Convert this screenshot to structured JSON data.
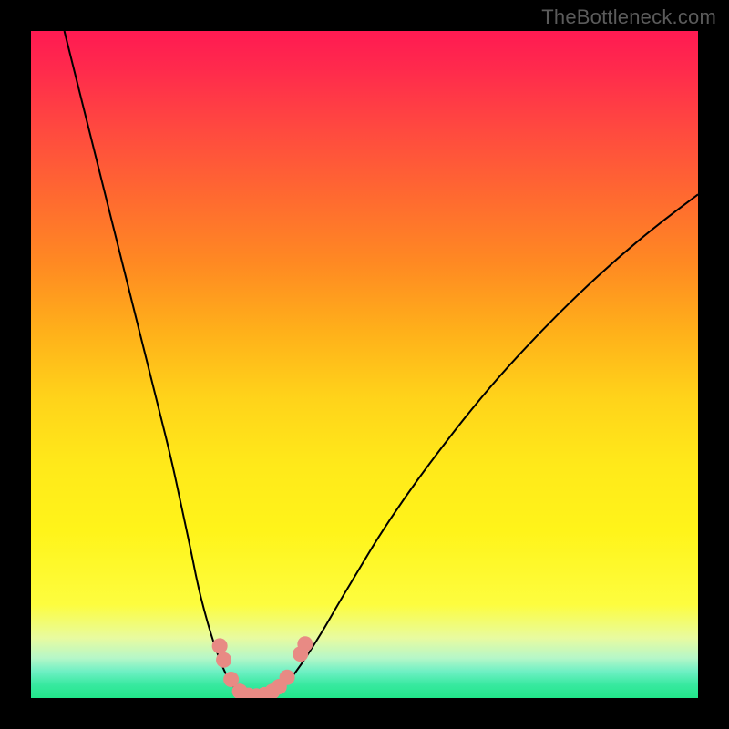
{
  "attribution": "TheBottleneck.com",
  "chart_data": {
    "type": "line",
    "title": "",
    "xlabel": "",
    "ylabel": "",
    "xlim": [
      0,
      100
    ],
    "ylim": [
      0,
      100
    ],
    "series": [
      {
        "name": "left-branch",
        "x": [
          5,
          7,
          9,
          11,
          13,
          15,
          17,
          19,
          21,
          22.5,
          24,
          25,
          26,
          27,
          28,
          29,
          30,
          30.8
        ],
        "y": [
          100,
          92,
          84,
          76,
          68,
          60,
          52,
          44,
          36,
          29,
          22,
          17,
          13,
          9.5,
          6.5,
          4,
          2.2,
          1.2
        ]
      },
      {
        "name": "valley",
        "x": [
          30.8,
          31.5,
          32.3,
          33.2,
          34.2,
          35.2,
          36.2,
          37,
          37.8
        ],
        "y": [
          1.2,
          0.6,
          0.3,
          0.2,
          0.2,
          0.3,
          0.6,
          1.0,
          1.6
        ]
      },
      {
        "name": "right-branch",
        "x": [
          37.8,
          39,
          40.5,
          42,
          44,
          46,
          49,
          52,
          56,
          60,
          65,
          70,
          76,
          82,
          88,
          94,
          100
        ],
        "y": [
          1.6,
          3.0,
          5.0,
          7.3,
          10.5,
          14.0,
          19.0,
          24.0,
          30.0,
          35.5,
          42.0,
          48.0,
          54.5,
          60.5,
          66.0,
          71.0,
          75.5
        ]
      }
    ],
    "markers": [
      {
        "x": 28.3,
        "y": 7.8
      },
      {
        "x": 28.9,
        "y": 5.7
      },
      {
        "x": 30.0,
        "y": 2.8
      },
      {
        "x": 31.3,
        "y": 1.0
      },
      {
        "x": 32.6,
        "y": 0.4
      },
      {
        "x": 33.8,
        "y": 0.3
      },
      {
        "x": 35.0,
        "y": 0.5
      },
      {
        "x": 36.2,
        "y": 1.0
      },
      {
        "x": 37.2,
        "y": 1.7
      },
      {
        "x": 38.4,
        "y": 3.1
      },
      {
        "x": 40.4,
        "y": 6.6
      },
      {
        "x": 41.1,
        "y": 8.1
      }
    ],
    "gradient_stops": [
      {
        "pos": 0.0,
        "color": "#ff1a52"
      },
      {
        "pos": 0.5,
        "color": "#ffd31a"
      },
      {
        "pos": 0.86,
        "color": "#fdfd3f"
      },
      {
        "pos": 1.0,
        "color": "#22e58a"
      }
    ]
  }
}
